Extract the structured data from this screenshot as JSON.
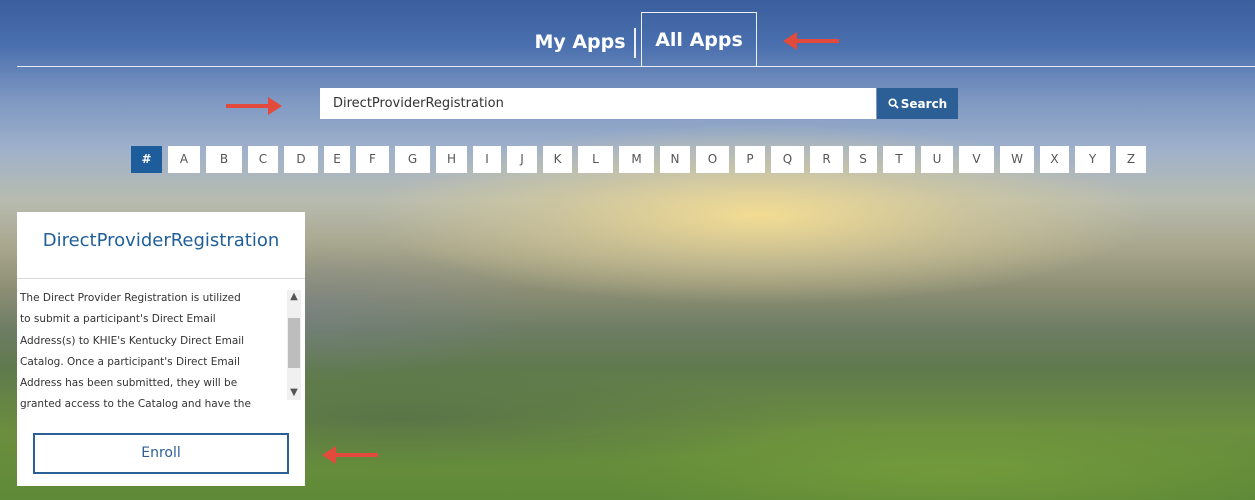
{
  "nav": {
    "tabs": [
      {
        "label": "My Apps"
      },
      {
        "label": "All Apps",
        "active": true
      }
    ]
  },
  "search": {
    "value": "DirectProviderRegistration",
    "button_label": "Search",
    "button_icon": "search-icon"
  },
  "alphabet": {
    "items": [
      "#",
      "A",
      "B",
      "C",
      "D",
      "E",
      "F",
      "G",
      "H",
      "I",
      "J",
      "K",
      "L",
      "M",
      "N",
      "O",
      "P",
      "Q",
      "R",
      "S",
      "T",
      "U",
      "V",
      "W",
      "X",
      "Y",
      "Z"
    ],
    "selected": "#"
  },
  "app_card": {
    "title": "DirectProviderRegistration",
    "description_lines": [
      "The Direct Provider Registration is utilized",
      "to submit a participant's Direct Email",
      "Address(s) to KHIE's Kentucky Direct Email",
      "Catalog. Once a participant's Direct Email",
      "Address has been submitted, they will be",
      "granted access to the Catalog and have the"
    ],
    "enroll_label": "Enroll"
  },
  "colors": {
    "accent": "#2c5f96",
    "active_letter": "#1e5d9c",
    "annotation_arrow": "#e24a3b"
  }
}
